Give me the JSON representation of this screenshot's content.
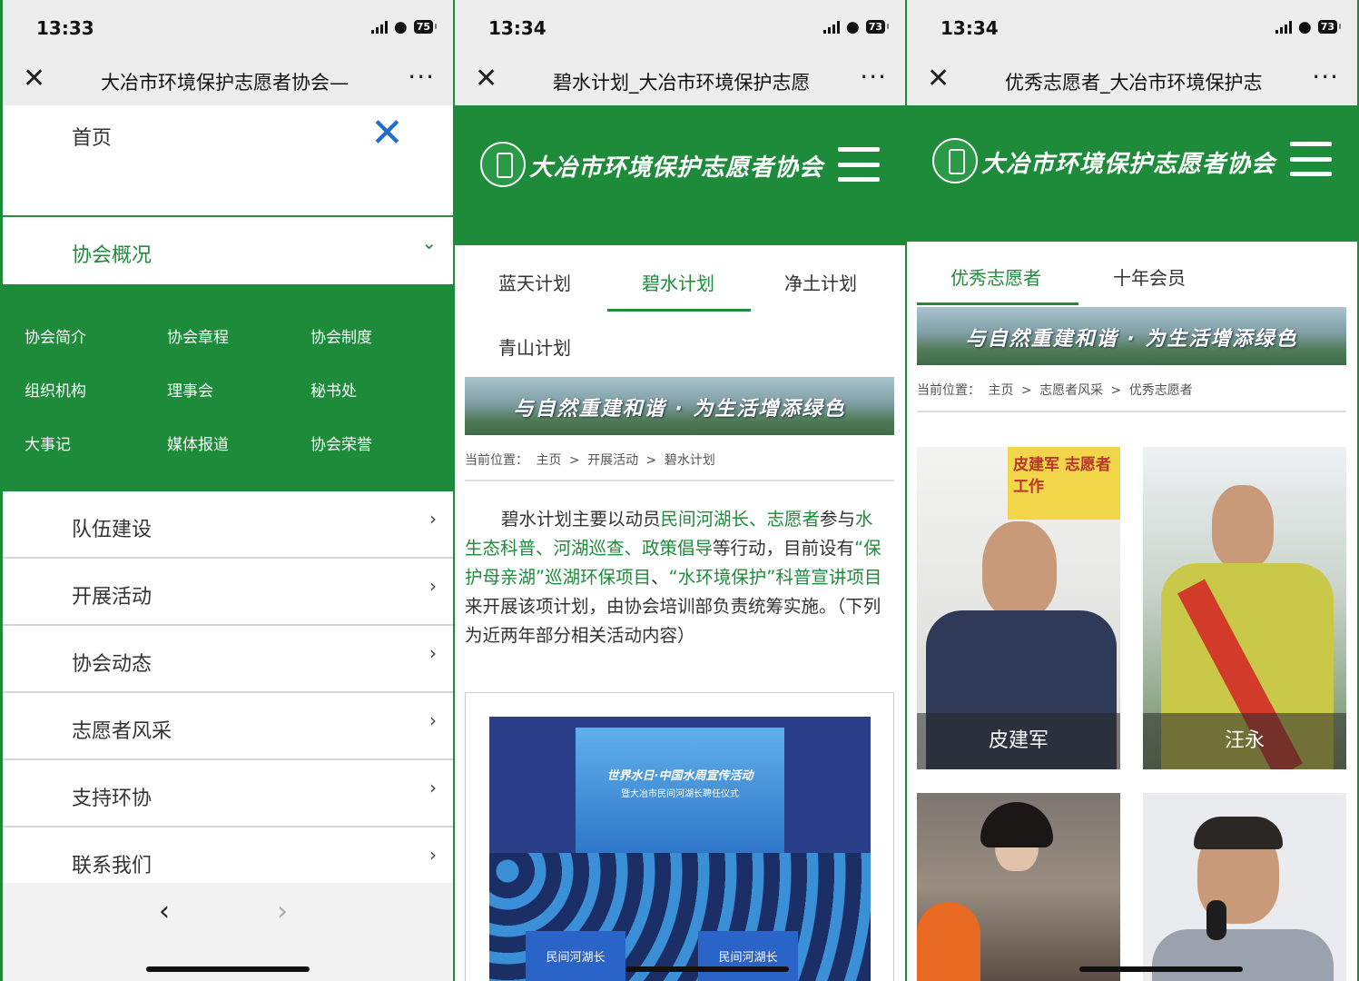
{
  "colors": {
    "brand_green": "#1e8b3a",
    "link_green": "#1f8b3b",
    "close_blue": "#1e6fd0"
  },
  "panel1": {
    "status": {
      "time": "13:33",
      "battery": "75"
    },
    "nav_title": "大冶市环境保护志愿者协会—",
    "menu": {
      "home": "首页",
      "expanded": "协会概况",
      "submenu": [
        "协会简介",
        "协会章程",
        "协会制度",
        "组织机构",
        "理事会",
        "秘书处",
        "大事记",
        "媒体报道",
        "协会荣誉"
      ],
      "items": [
        "队伍建设",
        "开展活动",
        "协会动态",
        "志愿者风采",
        "支持环协",
        "联系我们"
      ]
    }
  },
  "panel2": {
    "status": {
      "time": "13:34",
      "battery": "73"
    },
    "nav_title": "碧水计划_大冶市环境保护志愿",
    "site_name": "大冶市环境保护志愿者协会",
    "tabs": [
      "蓝天计划",
      "碧水计划",
      "净土计划",
      "青山计划"
    ],
    "active_tab": "碧水计划",
    "banner": "与自然重建和谐 · 为生活增添绿色",
    "breadcrumb": {
      "label": "当前位置：",
      "path": [
        "主页",
        ">",
        "开展活动",
        ">",
        "碧水计划"
      ]
    },
    "paragraph": {
      "p1": "碧水计划主要以动员",
      "l1": "民间河湖长、志愿者",
      "p2": "参与",
      "l2": "水生态科普、河湖巡查、政策倡导",
      "p3": "等行动，目前设有",
      "l3": "“保护母亲湖”巡湖环保项目",
      "p4": "、",
      "l4": "“水环境保护”科普宣讲项目",
      "p5": "来开展该项计划，由协会培训部负责统筹实施。（下列为近两年部分相关活动内容）"
    },
    "photo": {
      "screen_title": "世界水日·中国水周宣传活动",
      "screen_sub": "暨大冶市民间河湖长聘任仪式",
      "vest_text": "民间河湖长"
    }
  },
  "panel3": {
    "status": {
      "time": "13:34",
      "battery": "73"
    },
    "nav_title": "优秀志愿者_大冶市环境保护志",
    "site_name": "大冶市环境保护志愿者协会",
    "tabs": [
      "优秀志愿者",
      "十年会员"
    ],
    "active_tab": "优秀志愿者",
    "banner": "与自然重建和谐 · 为生活增添绿色",
    "breadcrumb": {
      "label": "当前位置：",
      "path": [
        "主页",
        ">",
        "志愿者风采",
        ">",
        "优秀志愿者"
      ]
    },
    "volunteers": [
      {
        "name": "皮建军",
        "sign": "皮建军 志愿者工作"
      },
      {
        "name": "汪永",
        "sign": ""
      },
      {
        "name": "",
        "sign": ""
      },
      {
        "name": "",
        "sign": ""
      }
    ]
  }
}
